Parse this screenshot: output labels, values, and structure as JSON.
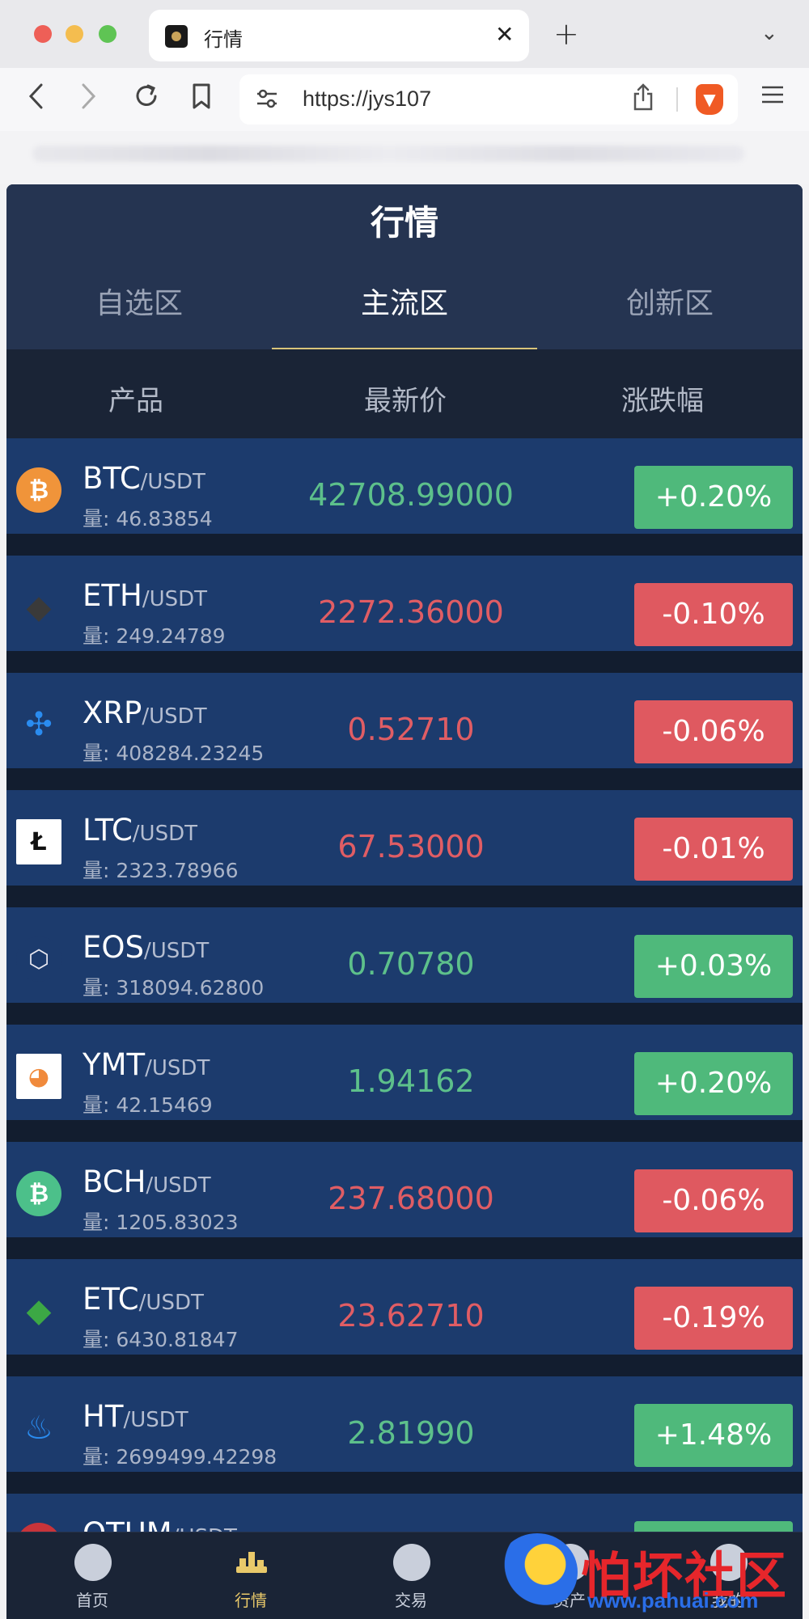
{
  "browser": {
    "tab_title": "行情",
    "tab_close": "✕",
    "new_tab": "+",
    "tab_menu": "⌄",
    "url": "https://jys107",
    "icons": [
      "back-icon",
      "forward-icon",
      "reload-icon",
      "bookmark-icon",
      "site-settings-icon",
      "share-icon",
      "brave-shield-icon",
      "menu-icon"
    ]
  },
  "header": {
    "title": "行情",
    "tabs": [
      {
        "label": "自选区",
        "active": false
      },
      {
        "label": "主流区",
        "active": true
      },
      {
        "label": "创新区",
        "active": false
      }
    ]
  },
  "columns": {
    "product": "产品",
    "price": "最新价",
    "change": "涨跌幅"
  },
  "coins": [
    {
      "symbol": "BTC",
      "quote": "/USDT",
      "volume": "量: 46.83854",
      "price": "42708.99000",
      "change": "+0.20%",
      "direction": "up",
      "icon": "bitcoin-icon",
      "icon_color": "#f0943a"
    },
    {
      "symbol": "ETH",
      "quote": "/USDT",
      "volume": "量: 249.24789",
      "price": "2272.36000",
      "change": "-0.10%",
      "direction": "down",
      "icon": "ethereum-icon",
      "icon_color": "#3a3a3a"
    },
    {
      "symbol": "XRP",
      "quote": "/USDT",
      "volume": "量: 408284.23245",
      "price": "0.52710",
      "change": "-0.06%",
      "direction": "down",
      "icon": "ripple-icon",
      "icon_color": "#2a8cf0"
    },
    {
      "symbol": "LTC",
      "quote": "/USDT",
      "volume": "量: 2323.78966",
      "price": "67.53000",
      "change": "-0.01%",
      "direction": "down",
      "icon": "litecoin-icon",
      "icon_color": "#ffffff"
    },
    {
      "symbol": "EOS",
      "quote": "/USDT",
      "volume": "量: 318094.62800",
      "price": "0.70780",
      "change": "+0.03%",
      "direction": "up",
      "icon": "eos-icon",
      "icon_color": "#1c3b6d"
    },
    {
      "symbol": "YMT",
      "quote": "/USDT",
      "volume": "量: 42.15469",
      "price": "1.94162",
      "change": "+0.20%",
      "direction": "up",
      "icon": "ymt-icon",
      "icon_color": "#ffffff"
    },
    {
      "symbol": "BCH",
      "quote": "/USDT",
      "volume": "量: 1205.83023",
      "price": "237.68000",
      "change": "-0.06%",
      "direction": "down",
      "icon": "bitcoin-cash-icon",
      "icon_color": "#4cc08a"
    },
    {
      "symbol": "ETC",
      "quote": "/USDT",
      "volume": "量: 6430.81847",
      "price": "23.62710",
      "change": "-0.19%",
      "direction": "down",
      "icon": "ethereum-classic-icon",
      "icon_color": "#3ca845"
    },
    {
      "symbol": "HT",
      "quote": "/USDT",
      "volume": "量: 2699499.42298",
      "price": "2.81990",
      "change": "+1.48%",
      "direction": "up",
      "icon": "huobi-token-icon",
      "icon_color": "#2a8cf0"
    },
    {
      "symbol": "QTUM",
      "quote": "/USDT",
      "volume": "",
      "price": "",
      "change": "",
      "direction": "up",
      "icon": "qtum-icon",
      "icon_color": "#c8343a"
    }
  ],
  "bottom_nav": [
    {
      "label": "首页",
      "icon": "home-icon",
      "active": false
    },
    {
      "label": "行情",
      "icon": "market-icon",
      "active": true
    },
    {
      "label": "交易",
      "icon": "trade-icon",
      "active": false
    },
    {
      "label": "资产",
      "icon": "assets-icon",
      "active": false
    },
    {
      "label": "我的",
      "icon": "profile-icon",
      "active": false
    }
  ],
  "watermark": {
    "text": "怕坏社区",
    "url": "www.pahuai.com"
  },
  "colors": {
    "up": "#5dc08b",
    "down": "#e05d64",
    "up_badge": "#4fb97b",
    "down_badge": "#df5960",
    "row_bg": "#1c3b6d",
    "accent": "#d9c47a"
  }
}
